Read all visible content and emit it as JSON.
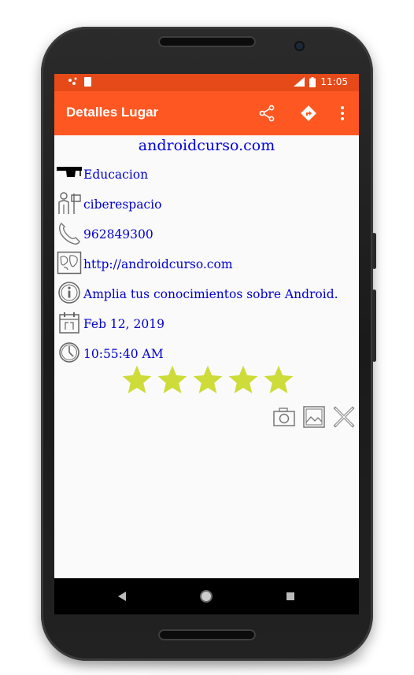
{
  "status_bar": {
    "left_icons": "notification-icons",
    "time": "11:05"
  },
  "app_bar": {
    "title": "Detalles Lugar"
  },
  "place": {
    "name": "androidcurso.com",
    "type": "Educacion",
    "address": "ciberespacio",
    "phone": "962849300",
    "url": "http://androidcurso.com",
    "comment": "Amplia tus conocimientos sobre Android.",
    "date": "Feb 12, 2019",
    "time": "10:55:40 AM",
    "rating": 5,
    "rating_max": 5
  },
  "colors": {
    "accent": "#ff5722",
    "status": "#e64a19",
    "link_text": "#0000e0",
    "star": "#cddc39"
  },
  "icons": [
    "share-icon",
    "directions-icon",
    "overflow-menu-icon",
    "graduation-cap-icon",
    "person-sign-icon",
    "phone-icon",
    "map-icon",
    "info-icon",
    "calendar-icon",
    "clock-icon",
    "camera-icon",
    "gallery-icon",
    "delete-icon"
  ]
}
